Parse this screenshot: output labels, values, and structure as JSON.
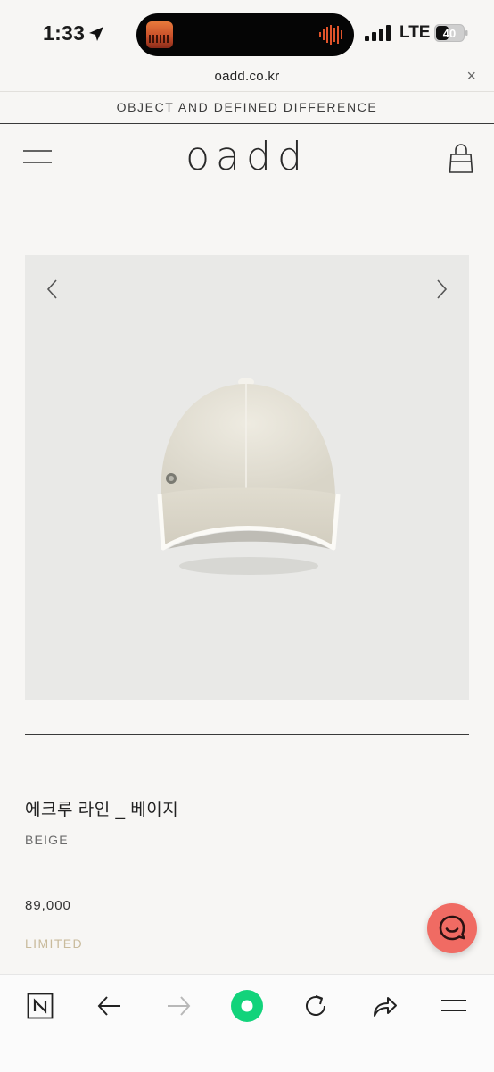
{
  "status_bar": {
    "time": "1:33",
    "carrier": "LTE",
    "battery": "40"
  },
  "browser": {
    "url": "oadd.co.kr",
    "close_label": "×"
  },
  "site": {
    "banner": "OBJECT AND DEFINED DIFFERENCE",
    "logo": "oadd"
  },
  "product": {
    "name": "에크루 라인 _ 베이지",
    "color": "BEIGE",
    "price": "89,000",
    "tag": "LIMITED"
  },
  "colors": {
    "background": "#f7f6f4",
    "image_background": "#e9e9e7",
    "chat_accent": "#f06b63",
    "browser_accent": "#12d37b",
    "limited_tag": "#c9bb9c"
  },
  "icons": {
    "menu": "hamburger-icon",
    "bag": "shopping-bag-icon",
    "prev": "chevron-left-icon",
    "next": "chevron-right-icon",
    "chat": "chat-icon",
    "toolbar": [
      "naver-home-icon",
      "back-arrow-icon",
      "forward-arrow-icon",
      "green-dot-icon",
      "reload-icon",
      "share-icon",
      "menu-icon"
    ]
  }
}
